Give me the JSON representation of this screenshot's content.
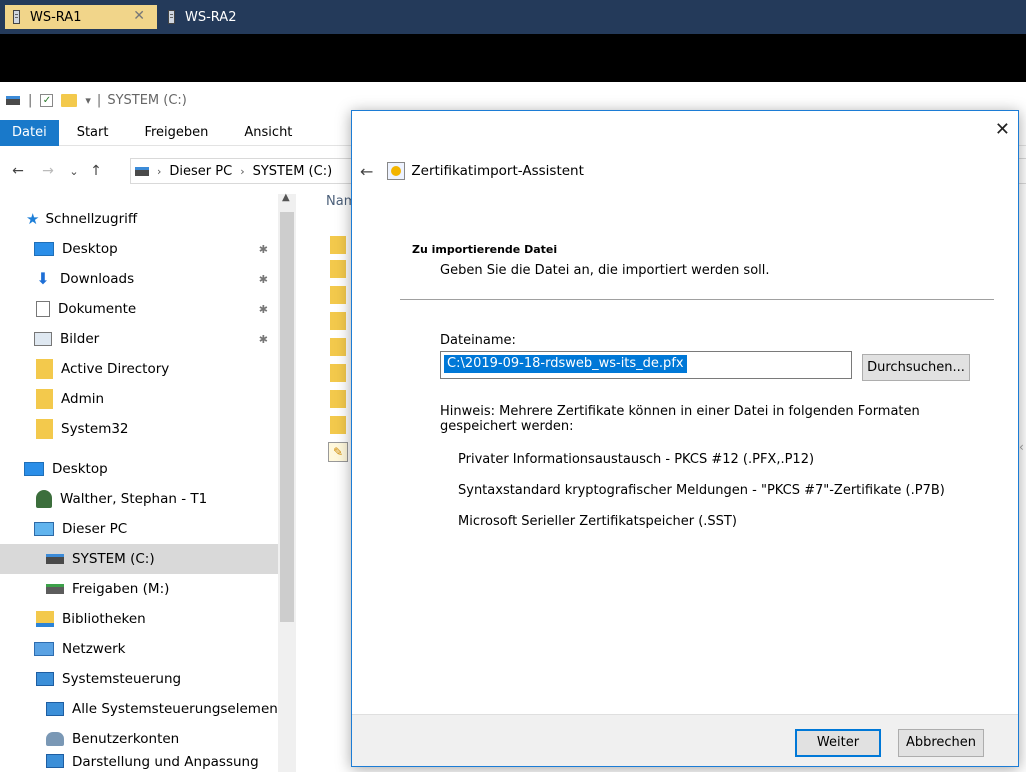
{
  "session_tabs": [
    {
      "label": "WS-RA1",
      "close": "✕",
      "active": true
    },
    {
      "label": "WS-RA2",
      "active": false
    }
  ],
  "explorer": {
    "qat": {
      "separator": "|",
      "dropdown": "▾",
      "title": "SYSTEM (C:)"
    },
    "ribbon_tabs": [
      "Datei",
      "Start",
      "Freigeben",
      "Ansicht"
    ],
    "nav": {
      "back": "←",
      "forward": "→",
      "recent": "⌄",
      "up": "↑"
    },
    "breadcrumb": [
      "Dieser PC",
      "SYSTEM (C:)"
    ],
    "breadcrumb_sep": "›",
    "tree": [
      {
        "label": "Schnellzugriff",
        "icon": "star-icon"
      },
      {
        "label": "Desktop",
        "icon": "desktop-icon",
        "pinned": true
      },
      {
        "label": "Downloads",
        "icon": "download-icon",
        "pinned": true
      },
      {
        "label": "Dokumente",
        "icon": "document-icon",
        "pinned": true
      },
      {
        "label": "Bilder",
        "icon": "pictures-icon",
        "pinned": true
      },
      {
        "label": "Active Directory",
        "icon": "folder-icon"
      },
      {
        "label": "Admin",
        "icon": "folder-icon"
      },
      {
        "label": "System32",
        "icon": "folder-icon"
      },
      {
        "label": "Desktop",
        "icon": "desktop-icon"
      },
      {
        "label": "Walther, Stephan - T1",
        "icon": "user-icon"
      },
      {
        "label": "Dieser PC",
        "icon": "computer-icon"
      },
      {
        "label": "SYSTEM (C:)",
        "icon": "drive-icon",
        "selected": true
      },
      {
        "label": "Freigaben (M:)",
        "icon": "network-drive-icon"
      },
      {
        "label": "Bibliotheken",
        "icon": "library-icon"
      },
      {
        "label": "Netzwerk",
        "icon": "network-icon"
      },
      {
        "label": "Systemsteuerung",
        "icon": "control-panel-icon"
      },
      {
        "label": "Alle Systemsteuerungselemente",
        "icon": "control-panel-icon"
      },
      {
        "label": "Benutzerkonten",
        "icon": "users-icon"
      },
      {
        "label": "Darstellung und Anpassung",
        "icon": "control-panel-icon"
      }
    ],
    "pin_glyph": "✱",
    "file_header": "Nam"
  },
  "dialog": {
    "close": "✕",
    "back": "←",
    "title": "Zertifikatimport-Assistent",
    "section_title": "Zu importierende Datei",
    "section_subtitle": "Geben Sie die Datei an, die importiert werden soll.",
    "filename_label": "Dateiname:",
    "filename_value": "C:\\2019-09-18-rdsweb_ws-its_de.pfx",
    "browse_label": "Durchsuchen...",
    "hint": "Hinweis: Mehrere Zertifikate können in einer Datei in folgenden Formaten gespeichert werden:",
    "formats": [
      "Privater Informationsaustausch - PKCS #12 (.PFX,.P12)",
      "Syntaxstandard kryptografischer Meldungen - \"PKCS #7\"-Zertifikate (.P7B)",
      "Microsoft Serieller Zertifikatspeicher (.SST)"
    ],
    "next_label": "Weiter",
    "cancel_label": "Abbrechen"
  },
  "colors": {
    "session_bar": "#243a5a",
    "active_session_tab": "#f1d58a",
    "ribbon_active": "#1979ca",
    "selection": "#0078d7"
  }
}
